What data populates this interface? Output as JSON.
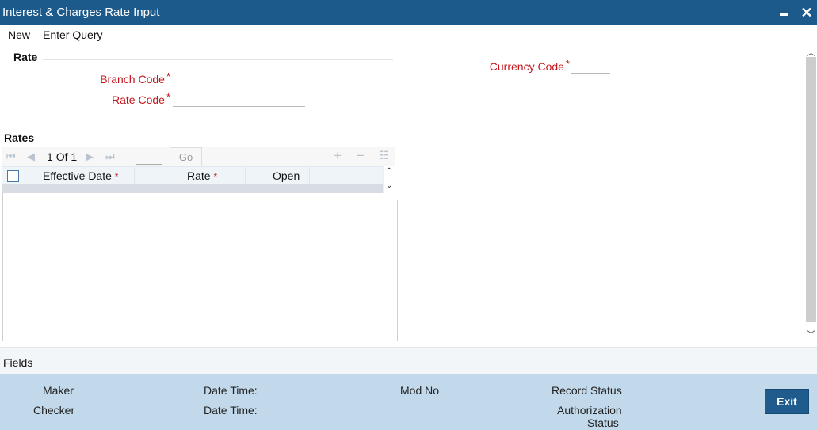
{
  "window": {
    "title": "Interest & Charges Rate Input",
    "close_glyph": "✕"
  },
  "menu": {
    "new_label": "New",
    "enter_query_label": "Enter Query"
  },
  "rate_section": {
    "heading": "Rate",
    "branch_code_label": "Branch Code",
    "rate_code_label": "Rate Code",
    "currency_code_label": "Currency Code",
    "required_marker": "*",
    "branch_code_value": "",
    "rate_code_value": "",
    "currency_code_value": ""
  },
  "rates_grid": {
    "heading": "Rates",
    "pager_current": "1",
    "pager_of": "Of",
    "pager_total": "1",
    "page_input_value": "",
    "go_label": "Go",
    "columns": [
      {
        "label": "Effective Date",
        "required": true
      },
      {
        "label": "Rate",
        "required": true
      },
      {
        "label": "Open",
        "required": false
      }
    ],
    "required_marker": "*",
    "icons": {
      "first": "first-page-icon",
      "prev": "previous-page-icon",
      "next": "next-page-icon",
      "last": "last-page-icon",
      "add": "add-row-icon",
      "delete": "delete-row-icon",
      "view": "single-view-icon"
    }
  },
  "fields_bar": {
    "label": "Fields"
  },
  "footer": {
    "maker_label": "Maker",
    "checker_label": "Checker",
    "date_time_label_1": "Date Time:",
    "date_time_label_2": "Date Time:",
    "mod_no_label": "Mod No",
    "record_status_label": "Record Status",
    "authorization_label": "Authorization",
    "status_label": "Status",
    "exit_label": "Exit"
  },
  "colors": {
    "titlebar": "#1c5a8c",
    "required_label": "#c4161c",
    "footer_bg": "#c1d9eb",
    "exit_button": "#1f5b8c"
  }
}
